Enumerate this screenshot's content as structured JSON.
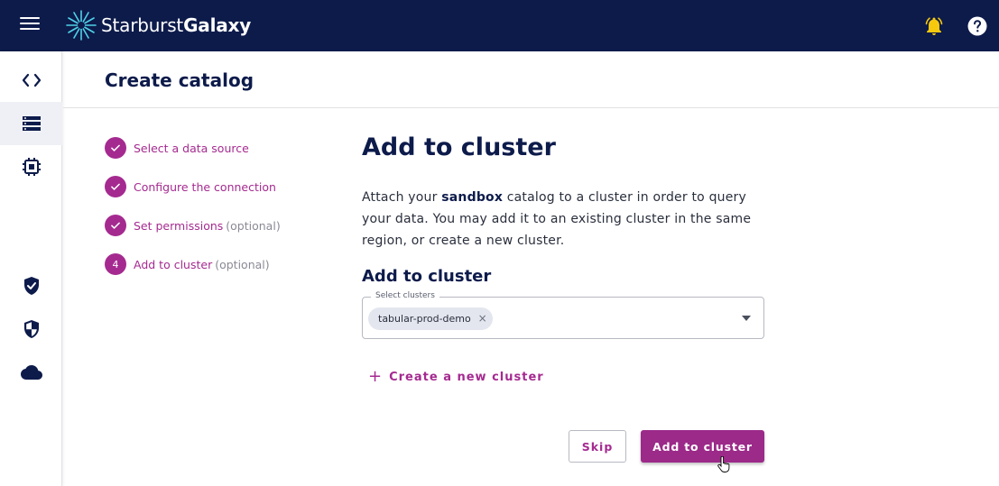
{
  "brand": {
    "name_light": "Starburst",
    "name_bold": "Galaxy",
    "logo_icon": "starburst-logo-icon"
  },
  "topbar": {
    "menu_icon": "hamburger-menu-icon",
    "notifications_icon": "bell-icon",
    "help_icon": "help-circle-icon",
    "colors": {
      "background": "#0d1b4b",
      "bell": "#f6c90e"
    }
  },
  "sidenav": {
    "items": [
      {
        "icon": "code-brackets-icon",
        "active": false
      },
      {
        "icon": "catalog-list-icon",
        "active": true
      },
      {
        "icon": "cluster-chip-icon",
        "active": false
      },
      {
        "icon": "shield-check-icon",
        "active": false
      },
      {
        "icon": "shield-half-icon",
        "active": false
      },
      {
        "icon": "cloud-icon",
        "active": false
      }
    ]
  },
  "page": {
    "title": "Create catalog"
  },
  "steps": [
    {
      "label": "Select a data source",
      "optional": "",
      "done": true
    },
    {
      "label": "Configure the connection",
      "optional": "",
      "done": true
    },
    {
      "label": "Set permissions",
      "optional": "(optional)",
      "done": true
    },
    {
      "label": "Add to cluster",
      "optional": "(optional)",
      "done": false,
      "number": "4"
    }
  ],
  "content": {
    "title": "Add to cluster",
    "description_prefix": "Attach your ",
    "catalog_name": "sandbox",
    "description_suffix": " catalog to a cluster in order to query your data. You may add it to an existing cluster in the same region, or create a new cluster.",
    "section_title": "Add to cluster",
    "select": {
      "label": "Select clusters",
      "chips": [
        "tabular-prod-demo"
      ],
      "chip_remove": "×"
    },
    "create_link": {
      "plus": "+",
      "label": "Create a new cluster"
    },
    "buttons": {
      "skip": "Skip",
      "add": "Add to cluster"
    }
  },
  "accent_color": "#a52a90"
}
